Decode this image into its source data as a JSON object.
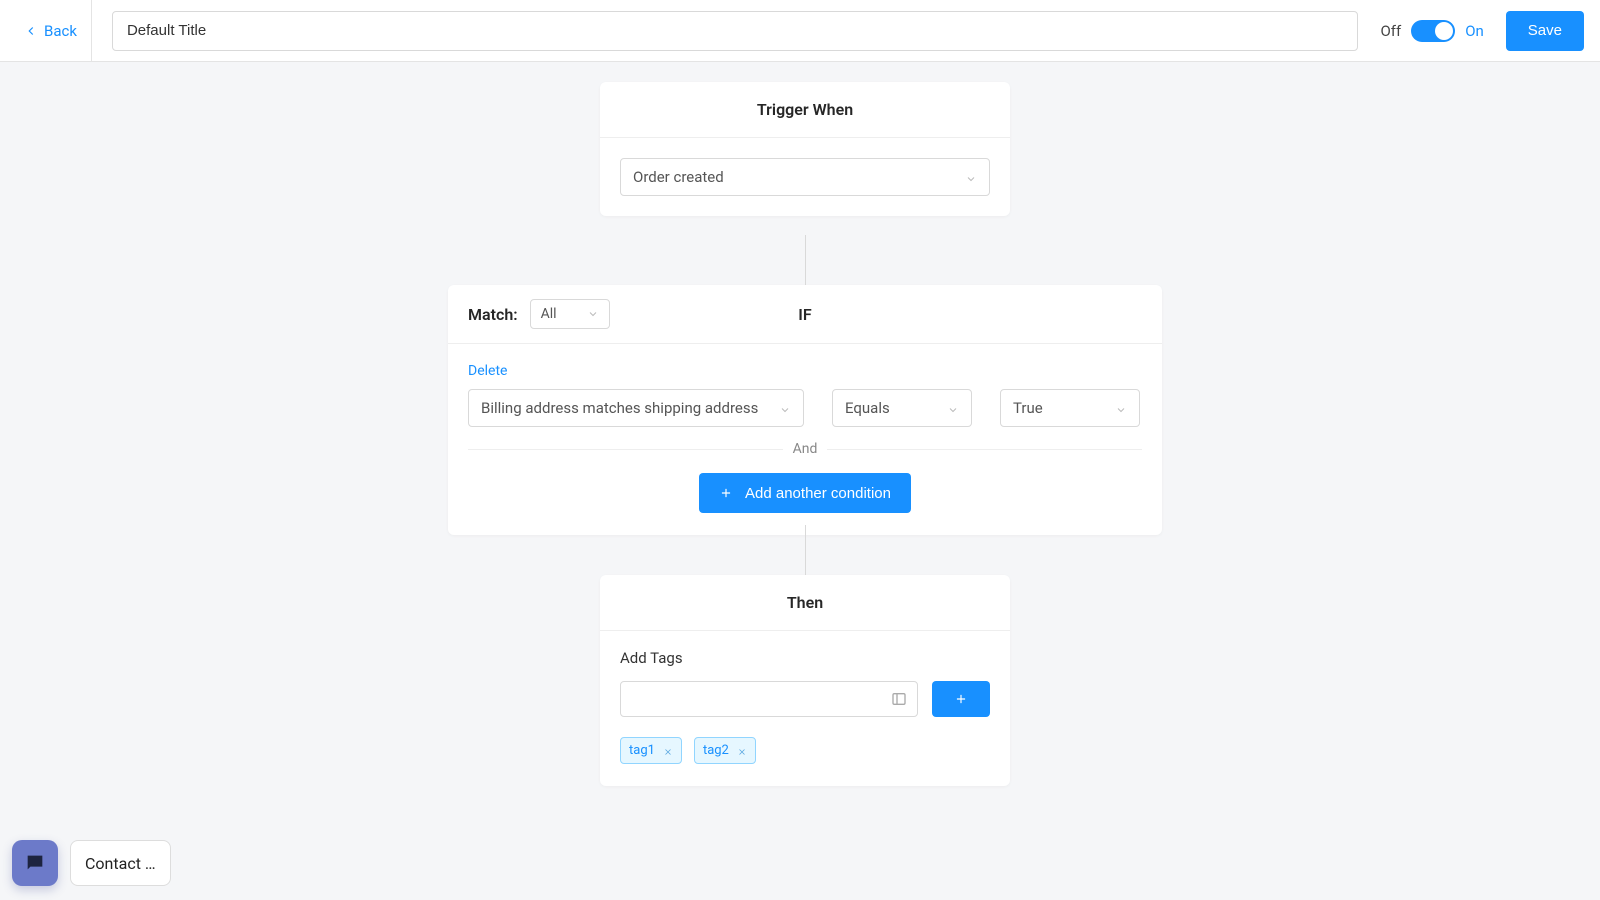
{
  "topbar": {
    "back": "Back",
    "title_value": "Default Title",
    "off": "Off",
    "on": "On",
    "save": "Save"
  },
  "trigger": {
    "header": "Trigger When",
    "selected": "Order created"
  },
  "ifcard": {
    "match_label": "Match:",
    "match_value": "All",
    "title": "IF",
    "delete": "Delete",
    "condition": {
      "field": "Billing address matches shipping address",
      "op": "Equals",
      "value": "True"
    },
    "and": "And",
    "add_button": "Add another condition"
  },
  "then": {
    "header": "Then",
    "add_tags_label": "Add Tags",
    "tags": [
      "tag1",
      "tag2"
    ]
  },
  "contact": {
    "label": "Contact …"
  }
}
